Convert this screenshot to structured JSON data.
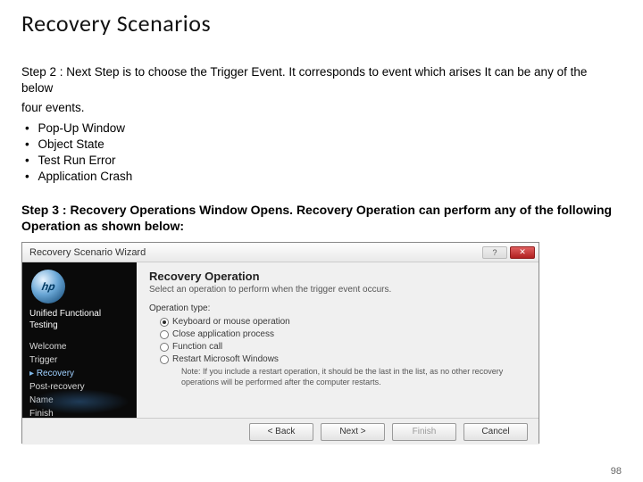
{
  "title": "Recovery Scenarios",
  "step2": {
    "line1": "Step 2 : Next Step is to choose the Trigger Event. It corresponds to event which arises It can be any of the below",
    "line2": "four events.",
    "bullets": [
      "Pop-Up Window",
      "Object State",
      "Test Run Error",
      "Application Crash"
    ]
  },
  "step3": "Step 3 : Recovery Operations Window Opens. Recovery Operation can perform any of the following Operation as shown below:",
  "wizard": {
    "title": "Recovery Scenario Wizard",
    "help_tip": "?",
    "close_tip": "✕",
    "product": "Unified Functional Testing",
    "side_steps": [
      "Welcome",
      "Trigger",
      "Recovery",
      "Post-recovery",
      "Name",
      "Finish"
    ],
    "active_step_index": 2,
    "heading": "Recovery Operation",
    "subheading": "Select an operation to perform when the trigger event occurs.",
    "operation_type_label": "Operation type:",
    "options": [
      "Keyboard or mouse operation",
      "Close application process",
      "Function call",
      "Restart Microsoft Windows"
    ],
    "selected_option_index": 0,
    "note": "Note: If you include a restart operation, it should be the last in the list, as no other recovery operations will be performed after the computer restarts.",
    "buttons": {
      "back": "< Back",
      "next": "Next >",
      "finish": "Finish",
      "cancel": "Cancel"
    }
  },
  "page_number": "98"
}
